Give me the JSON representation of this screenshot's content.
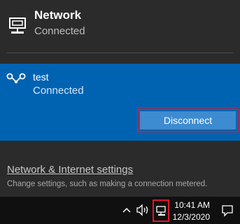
{
  "network": {
    "title": "Network",
    "status": "Connected",
    "icon": "ethernet-icon"
  },
  "vpn": {
    "name": "test",
    "status": "Connected",
    "icon": "vpn-icon",
    "disconnect_label": "Disconnect"
  },
  "settings": {
    "link_label": "Network & Internet settings",
    "description": "Change settings, such as making a connection metered."
  },
  "taskbar": {
    "time": "10:41 AM",
    "date": "12/3/2020",
    "icons": [
      "chevron-up-icon",
      "volume-icon",
      "network-icon",
      "notification-icon"
    ]
  },
  "colors": {
    "flyout_bg": "#2b2b2b",
    "accent": "#0063b1",
    "button": "#3d8bd1",
    "highlight": "#e0162b"
  }
}
